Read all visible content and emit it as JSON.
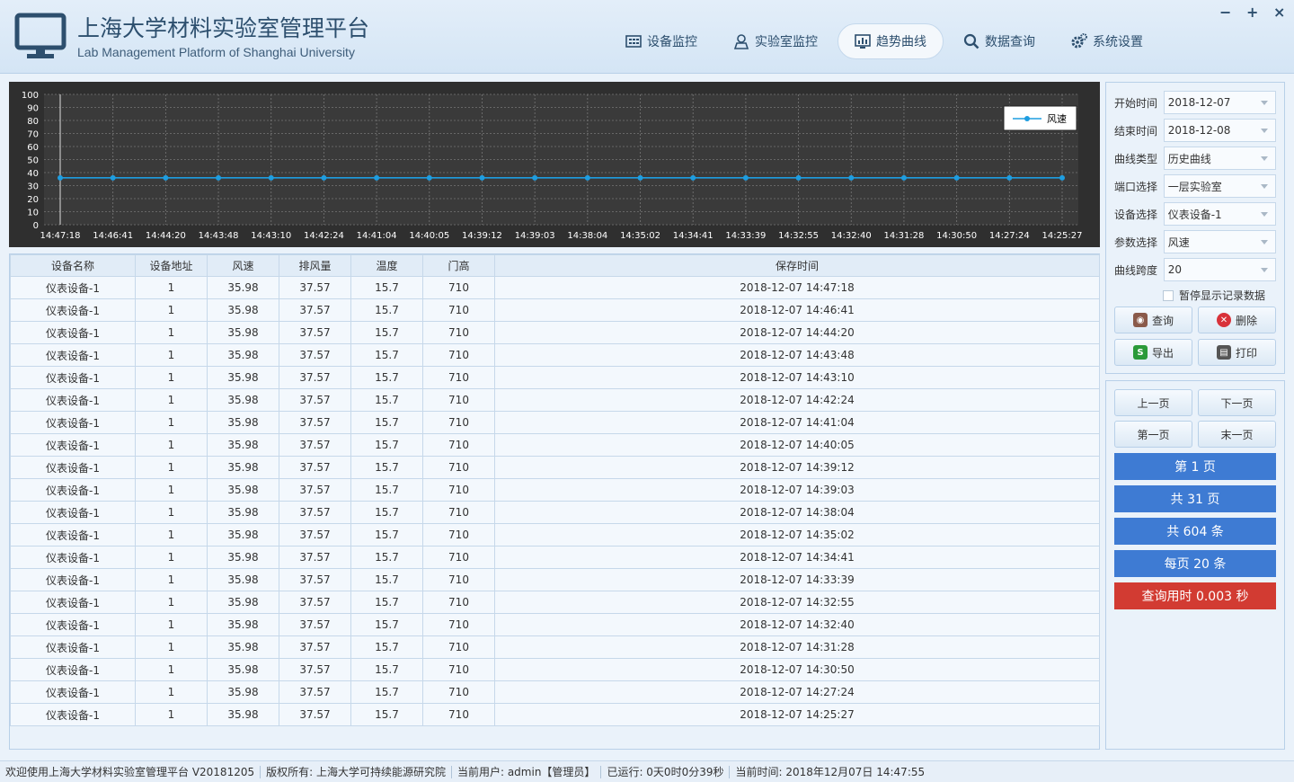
{
  "header": {
    "title": "上海大学材料实验室管理平台",
    "subtitle": "Lab Management Platform of Shanghai University"
  },
  "nav": [
    {
      "label": "设备监控",
      "icon": "device-monitor-icon"
    },
    {
      "label": "实验室监控",
      "icon": "lab-monitor-icon"
    },
    {
      "label": "趋势曲线",
      "icon": "trend-chart-icon",
      "active": true
    },
    {
      "label": "数据查询",
      "icon": "search-icon"
    },
    {
      "label": "系统设置",
      "icon": "settings-icon"
    }
  ],
  "window_controls": {
    "minimize": "−",
    "maximize": "+",
    "close": "×"
  },
  "chart_data": {
    "type": "line",
    "title": "",
    "xlabel": "",
    "ylabel": "",
    "ylim": [
      0,
      100
    ],
    "yticks": [
      0,
      10,
      20,
      30,
      40,
      50,
      60,
      70,
      80,
      90,
      100
    ],
    "grid": true,
    "legend": "top-right",
    "categories": [
      "14:47:18",
      "14:46:41",
      "14:44:20",
      "14:43:48",
      "14:43:10",
      "14:42:24",
      "14:41:04",
      "14:40:05",
      "14:39:12",
      "14:39:03",
      "14:38:04",
      "14:35:02",
      "14:34:41",
      "14:33:39",
      "14:32:55",
      "14:32:40",
      "14:31:28",
      "14:30:50",
      "14:27:24",
      "14:25:27"
    ],
    "series": [
      {
        "name": "风速",
        "color": "#1e9de0",
        "values": [
          35.98,
          35.98,
          35.98,
          35.98,
          35.98,
          35.98,
          35.98,
          35.98,
          35.98,
          35.98,
          35.98,
          35.98,
          35.98,
          35.98,
          35.98,
          35.98,
          35.98,
          35.98,
          35.98,
          35.98
        ]
      }
    ]
  },
  "table": {
    "columns": [
      "设备名称",
      "设备地址",
      "风速",
      "排风量",
      "温度",
      "门高",
      "保存时间"
    ],
    "rows": [
      [
        "仪表设备-1",
        "1",
        "35.98",
        "37.57",
        "15.7",
        "710",
        "2018-12-07 14:47:18"
      ],
      [
        "仪表设备-1",
        "1",
        "35.98",
        "37.57",
        "15.7",
        "710",
        "2018-12-07 14:46:41"
      ],
      [
        "仪表设备-1",
        "1",
        "35.98",
        "37.57",
        "15.7",
        "710",
        "2018-12-07 14:44:20"
      ],
      [
        "仪表设备-1",
        "1",
        "35.98",
        "37.57",
        "15.7",
        "710",
        "2018-12-07 14:43:48"
      ],
      [
        "仪表设备-1",
        "1",
        "35.98",
        "37.57",
        "15.7",
        "710",
        "2018-12-07 14:43:10"
      ],
      [
        "仪表设备-1",
        "1",
        "35.98",
        "37.57",
        "15.7",
        "710",
        "2018-12-07 14:42:24"
      ],
      [
        "仪表设备-1",
        "1",
        "35.98",
        "37.57",
        "15.7",
        "710",
        "2018-12-07 14:41:04"
      ],
      [
        "仪表设备-1",
        "1",
        "35.98",
        "37.57",
        "15.7",
        "710",
        "2018-12-07 14:40:05"
      ],
      [
        "仪表设备-1",
        "1",
        "35.98",
        "37.57",
        "15.7",
        "710",
        "2018-12-07 14:39:12"
      ],
      [
        "仪表设备-1",
        "1",
        "35.98",
        "37.57",
        "15.7",
        "710",
        "2018-12-07 14:39:03"
      ],
      [
        "仪表设备-1",
        "1",
        "35.98",
        "37.57",
        "15.7",
        "710",
        "2018-12-07 14:38:04"
      ],
      [
        "仪表设备-1",
        "1",
        "35.98",
        "37.57",
        "15.7",
        "710",
        "2018-12-07 14:35:02"
      ],
      [
        "仪表设备-1",
        "1",
        "35.98",
        "37.57",
        "15.7",
        "710",
        "2018-12-07 14:34:41"
      ],
      [
        "仪表设备-1",
        "1",
        "35.98",
        "37.57",
        "15.7",
        "710",
        "2018-12-07 14:33:39"
      ],
      [
        "仪表设备-1",
        "1",
        "35.98",
        "37.57",
        "15.7",
        "710",
        "2018-12-07 14:32:55"
      ],
      [
        "仪表设备-1",
        "1",
        "35.98",
        "37.57",
        "15.7",
        "710",
        "2018-12-07 14:32:40"
      ],
      [
        "仪表设备-1",
        "1",
        "35.98",
        "37.57",
        "15.7",
        "710",
        "2018-12-07 14:31:28"
      ],
      [
        "仪表设备-1",
        "1",
        "35.98",
        "37.57",
        "15.7",
        "710",
        "2018-12-07 14:30:50"
      ],
      [
        "仪表设备-1",
        "1",
        "35.98",
        "37.57",
        "15.7",
        "710",
        "2018-12-07 14:27:24"
      ],
      [
        "仪表设备-1",
        "1",
        "35.98",
        "37.57",
        "15.7",
        "710",
        "2018-12-07 14:25:27"
      ]
    ]
  },
  "filters": [
    {
      "label": "开始时间",
      "value": "2018-12-07"
    },
    {
      "label": "结束时间",
      "value": "2018-12-08"
    },
    {
      "label": "曲线类型",
      "value": "历史曲线"
    },
    {
      "label": "端口选择",
      "value": "一层实验室"
    },
    {
      "label": "设备选择",
      "value": "仪表设备-1"
    },
    {
      "label": "参数选择",
      "value": "风速"
    },
    {
      "label": "曲线跨度",
      "value": "20"
    }
  ],
  "pause_checkbox": {
    "label": "暂停显示记录数据",
    "checked": false
  },
  "actions": {
    "query": "查询",
    "delete": "删除",
    "export": "导出",
    "print": "打印"
  },
  "pagination": {
    "prev": "上一页",
    "next": "下一页",
    "first": "第一页",
    "last": "末一页",
    "current_page": "第 1 页",
    "total_pages": "共 31 页",
    "total_records": "共 604 条",
    "per_page": "每页 20 条",
    "query_time": "查询用时 0.003 秒"
  },
  "colors": {
    "info_blue": "#3e7bd3",
    "info_red": "#d23b32",
    "series": "#1e9de0"
  },
  "statusbar": [
    "欢迎使用上海大学材料实验室管理平台 V20181205",
    "版权所有: 上海大学可持续能源研究院",
    "当前用户: admin【管理员】",
    "已运行: 0天0时0分39秒",
    "当前时间: 2018年12月07日 14:47:55"
  ]
}
